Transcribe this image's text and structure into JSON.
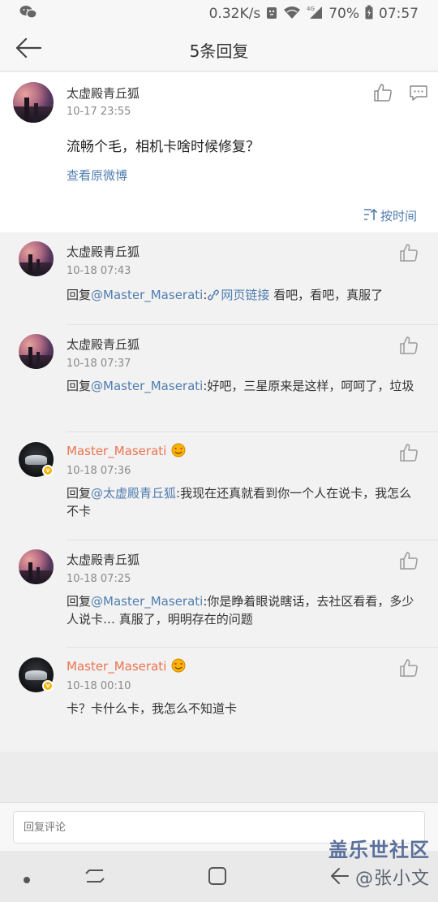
{
  "status_bar": {
    "speed": "0.32K/s",
    "network": "4G",
    "battery": "70%",
    "time": "07:57"
  },
  "nav": {
    "title": "5条回复"
  },
  "root_comment": {
    "username": "太虚殿青丘狐",
    "time": "10-17 23:55",
    "text": "流畅个毛，相机卡啥时候修复？",
    "view_original": "查看原微博",
    "sort_label": "按时间"
  },
  "replies": [
    {
      "username": "太虚殿青丘狐",
      "time": "10-18 07:43",
      "prefix": "回复",
      "mention": "@Master_Maserati",
      "sep": ":",
      "link_label": "网页链接",
      "text": " 看吧，看吧，真服了"
    },
    {
      "username": "太虚殿青丘狐",
      "time": "10-18 07:37",
      "prefix": "回复",
      "mention": "@Master_Maserati",
      "text": ":好吧，三星原来是这样，呵呵了，垃圾"
    },
    {
      "username": "Master_Maserati",
      "time": "10-18 07:36",
      "prefix": "回复",
      "mention": "@太虚殿青丘狐",
      "text": ":我现在还真就看到你一个人在说卡，我怎么不卡"
    },
    {
      "username": "太虚殿青丘狐",
      "time": "10-18 07:25",
      "prefix": "回复",
      "mention": "@Master_Maserati",
      "text": ":你是睁着眼说瞎话，去社区看看，多少人说卡… 真服了，明明存在的问题"
    },
    {
      "username": "Master_Maserati",
      "time": "10-18 00:10",
      "text": "卡？卡什么卡，我怎么不知道卡"
    }
  ],
  "comment_input": {
    "placeholder": "回复评论"
  },
  "watermark": {
    "line1": "盖乐世社区",
    "line2": "@张小文"
  },
  "colors": {
    "link": "#507daf",
    "orange_name": "#eb7350",
    "verified": "#f4b400"
  }
}
